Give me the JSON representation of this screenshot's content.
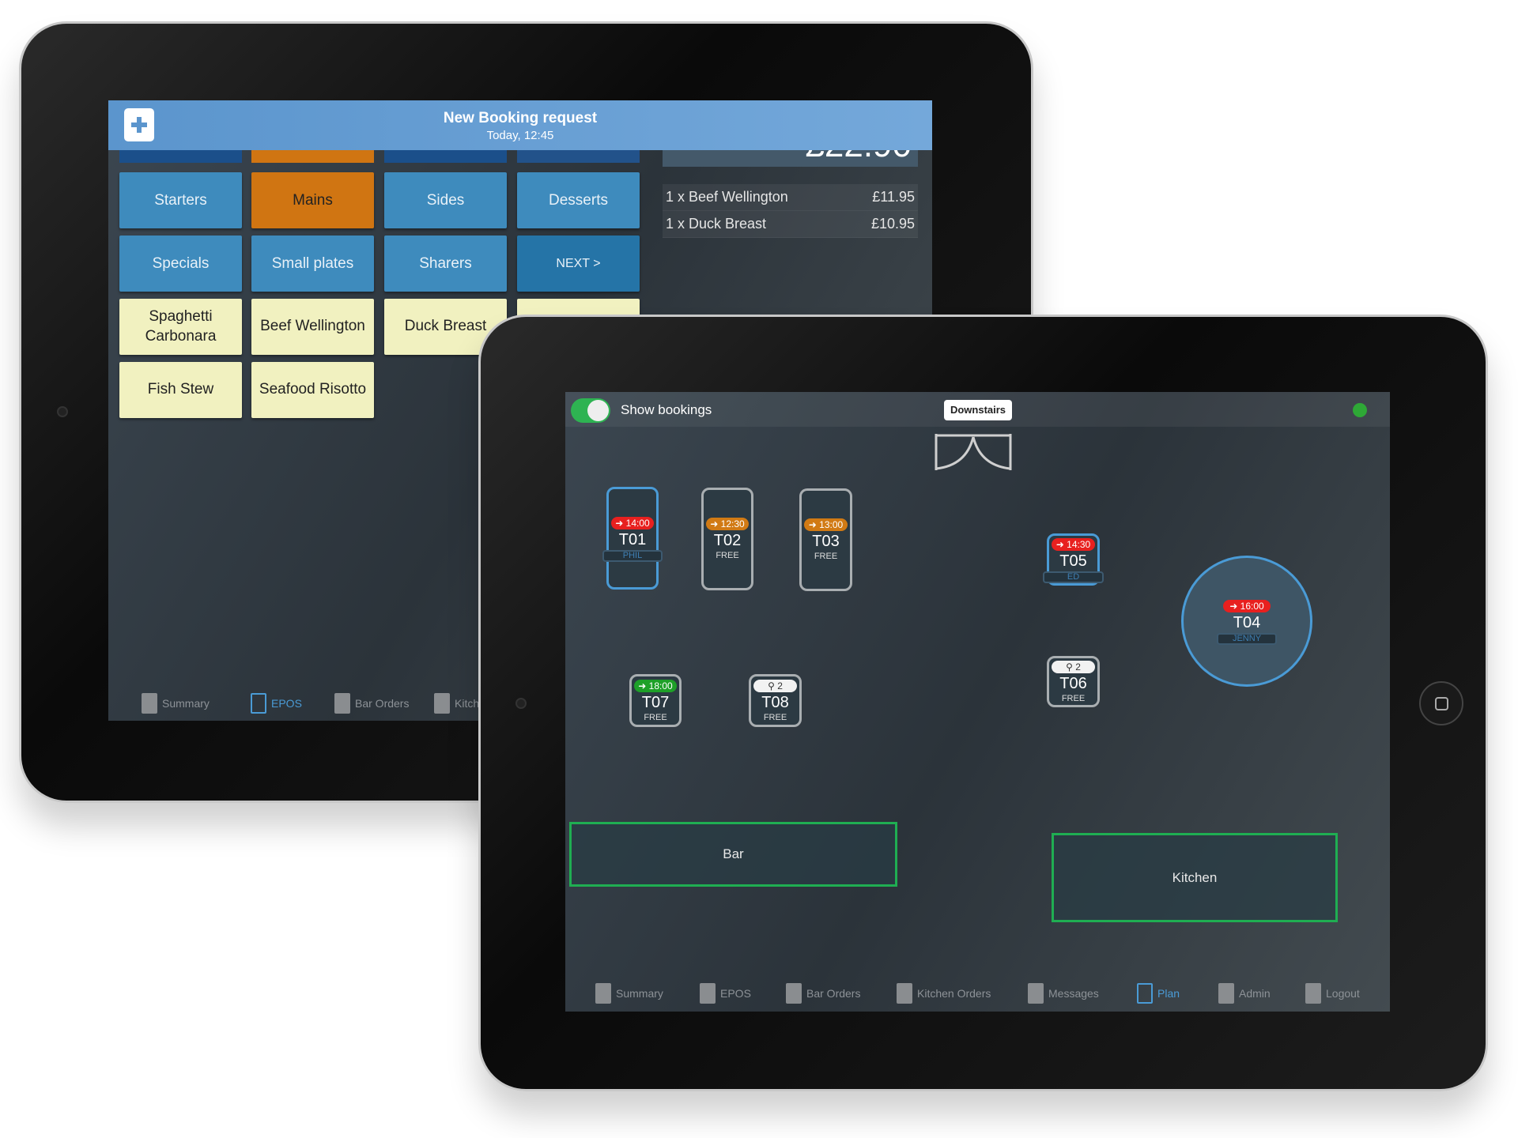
{
  "epos": {
    "notification": {
      "title": "New Booking request",
      "subtitle": "Today, 12:45",
      "icon": "calendar-plus-icon"
    },
    "total": "£22.90",
    "categories": [
      "Starters",
      "Mains",
      "Sides",
      "Desserts",
      "Specials",
      "Small plates",
      "Sharers",
      "NEXT >"
    ],
    "selected_category": "Mains",
    "items": [
      "Spaghetti Carbonara",
      "Beef Wellington",
      "Duck Breast",
      "",
      "Fish Stew",
      "Seafood Risotto"
    ],
    "order": [
      {
        "label": "1 x Beef Wellington",
        "price": "£11.95"
      },
      {
        "label": "1 x Duck Breast",
        "price": "£10.95"
      }
    ],
    "nav": [
      "Summary",
      "EPOS",
      "Bar Orders",
      "Kitch"
    ],
    "active_nav": "EPOS"
  },
  "plan": {
    "toggle_label": "Show bookings",
    "toggle_on": true,
    "floor": "Downstairs",
    "status_color": "#2ea836",
    "tables": [
      {
        "name": "T01",
        "time": "14:00",
        "status": "PHIL",
        "tag": "red"
      },
      {
        "name": "T02",
        "time": "12:30",
        "status": "FREE",
        "tag": "orange"
      },
      {
        "name": "T03",
        "time": "13:00",
        "status": "FREE",
        "tag": "orange"
      },
      {
        "name": "T05",
        "time": "14:30",
        "status": "ED",
        "tag": "red"
      },
      {
        "name": "T04",
        "time": "16:00",
        "status": "JENNY",
        "tag": "red"
      },
      {
        "name": "T06",
        "time": "2",
        "status": "FREE",
        "tag": "white"
      },
      {
        "name": "T07",
        "time": "18:00",
        "status": "FREE",
        "tag": "green"
      },
      {
        "name": "T08",
        "time": "2",
        "status": "FREE",
        "tag": "white"
      }
    ],
    "zones": [
      "Bar",
      "Kitchen"
    ],
    "nav": [
      "Summary",
      "EPOS",
      "Bar Orders",
      "Kitchen Orders",
      "Messages",
      "Plan",
      "Admin",
      "Logout"
    ],
    "active_nav": "Plan"
  }
}
